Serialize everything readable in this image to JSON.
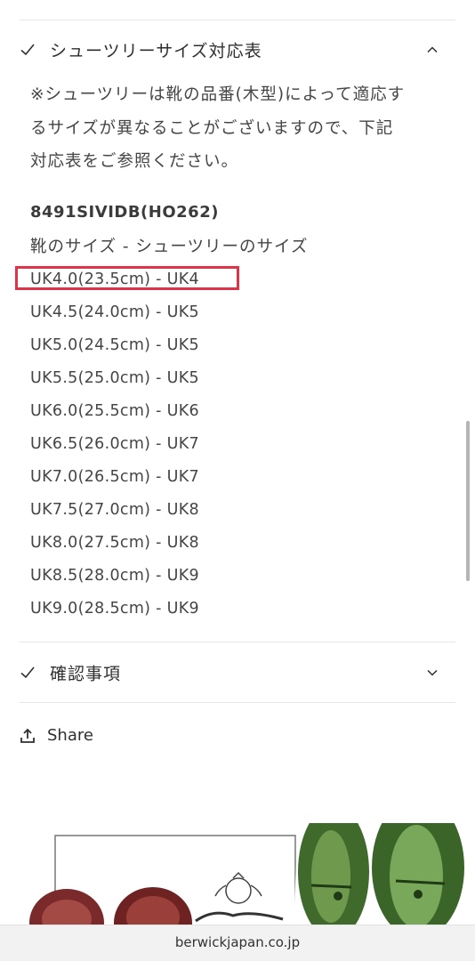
{
  "accordion_sizes": {
    "title": "シューツリーサイズ対応表",
    "note_lines": [
      "※シューツリーは靴の品番(木型)によって適応す",
      "るサイズが異なることがございますので、下記",
      "対応表をご参照ください。"
    ],
    "model": "8491SIVIDB(HO262)",
    "column_header": "靴のサイズ - シューツリーのサイズ",
    "rows": [
      "UK4.0(23.5cm) - UK4",
      "UK4.5(24.0cm) - UK5",
      "UK5.0(24.5cm) - UK5",
      "UK5.5(25.0cm) - UK5",
      "UK6.0(25.5cm) - UK6",
      "UK6.5(26.0cm) - UK7",
      "UK7.0(26.5cm) - UK7",
      "UK7.5(27.0cm) - UK8",
      "UK8.0(27.5cm) - UK8",
      "UK8.5(28.0cm) - UK9",
      "UK9.0(28.5cm) - UK9"
    ]
  },
  "accordion_confirm": {
    "title": "確認事項"
  },
  "share": {
    "label": "Share"
  },
  "url_bar": {
    "url": "berwickjapan.co.jp"
  },
  "icons": {
    "check": "check-icon",
    "chevron_up": "chevron-up-icon",
    "chevron_down": "chevron-down-icon",
    "share": "share-upload-icon"
  },
  "colors": {
    "highlight_box": "#e0334a",
    "text": "#454545"
  }
}
